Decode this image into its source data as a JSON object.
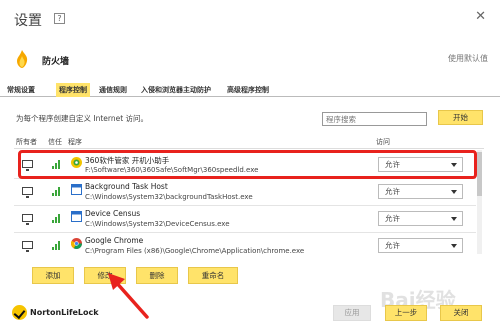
{
  "window": {
    "title": "设置",
    "help_glyph": "?",
    "close_glyph": "✕"
  },
  "section": {
    "title": "防火墙",
    "defaults_link": "使用默认值"
  },
  "tabs": [
    {
      "label": "常规设置",
      "active": false
    },
    {
      "label": "程序控制",
      "active": true
    },
    {
      "label": "通信规则",
      "active": false
    },
    {
      "label": "入侵和浏览器主动防护",
      "active": false
    },
    {
      "label": "高级程序控制",
      "active": false
    }
  ],
  "program_control": {
    "description": "为每个程序创建自定义 Internet 访问。",
    "search_placeholder": "程序搜索",
    "start_label": "开始",
    "columns": {
      "owner": "所有者",
      "trust": "信任",
      "program": "程序",
      "access": "访问"
    }
  },
  "programs": [
    {
      "name": "360软件管家 开机小助手",
      "path": "F:\\Software\\360\\360Safe\\SoftMgr\\360speedld.exe",
      "access": "允许",
      "icon": "360-icon"
    },
    {
      "name": "Background Task Host",
      "path": "C:\\Windows\\System32\\backgroundTaskHost.exe",
      "access": "允许",
      "icon": "window-app-icon"
    },
    {
      "name": "Device Census",
      "path": "C:\\Windows\\System32\\DeviceCensus.exe",
      "access": "允许",
      "icon": "window-app-icon"
    },
    {
      "name": "Google Chrome",
      "path": "C:\\Program Files (x86)\\Google\\Chrome\\Application\\chrome.exe",
      "access": "允许",
      "icon": "chrome-icon"
    }
  ],
  "actions": {
    "add": "添加",
    "modify": "修改",
    "delete": "删除",
    "rename": "重命名"
  },
  "footer": {
    "brand": "NortonLifeLock",
    "apply": "应用",
    "back": "上一步",
    "close": "关闭"
  },
  "watermark": "Bai经验",
  "colors": {
    "accent": "#ffe36a",
    "highlight": "#e8221d",
    "trust": "#3aa63a"
  }
}
